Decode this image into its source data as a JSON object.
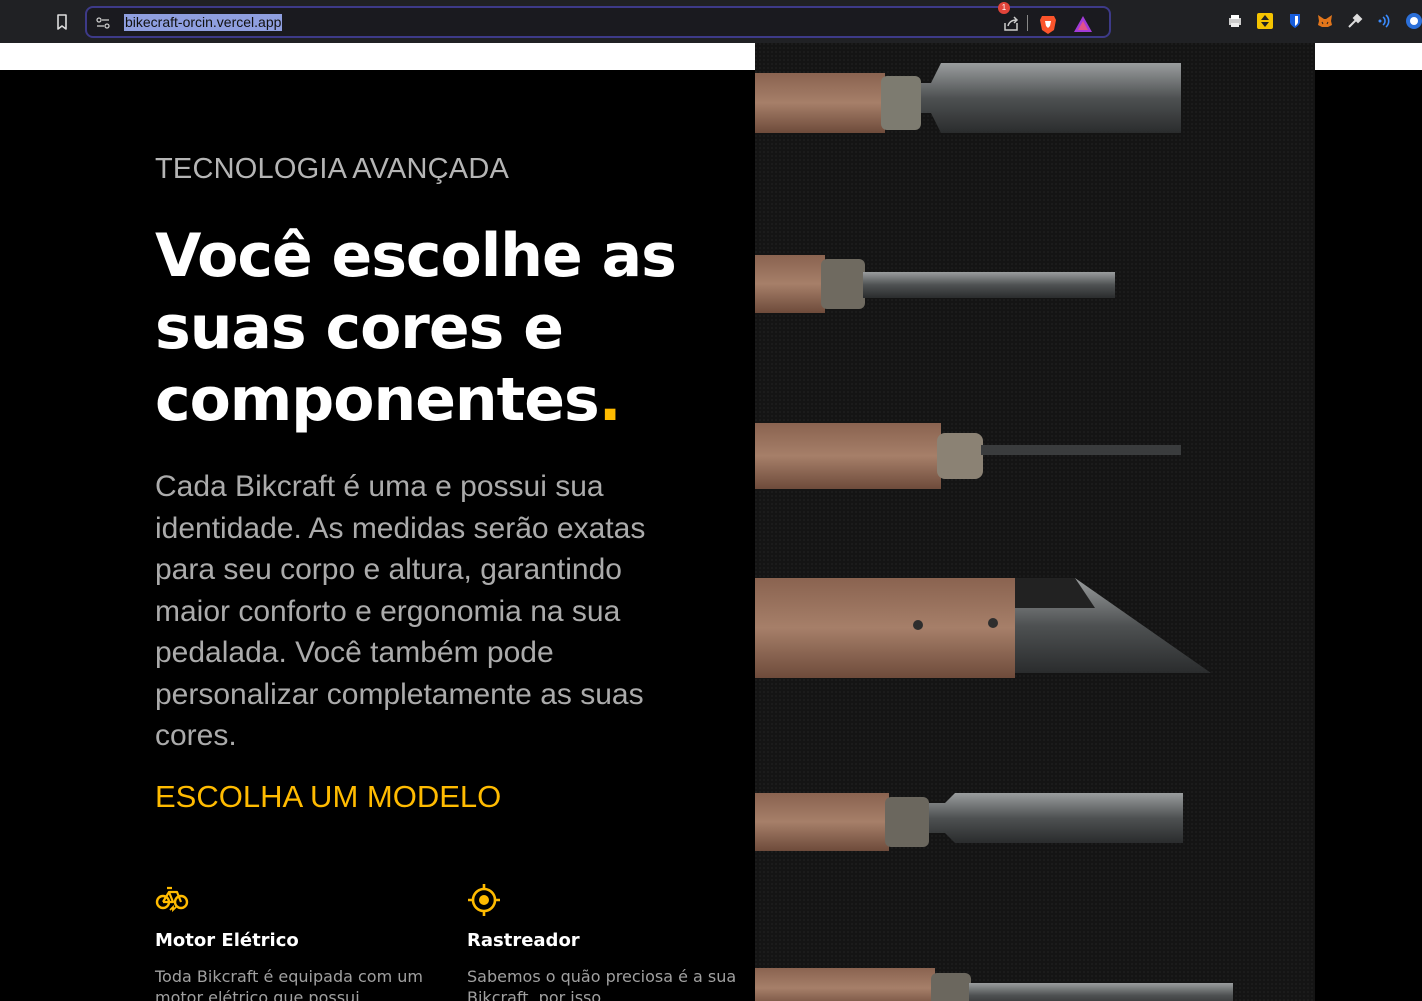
{
  "browser": {
    "url": "bikecraft-orcin.vercel.app",
    "rewards_badge": "1",
    "icons": [
      "bookmark-icon",
      "site-info-icon",
      "share-icon",
      "brave-lion-icon",
      "brave-rewards-icon",
      "print-icon",
      "extension-yellow-icon",
      "bitwarden-icon",
      "metamask-fox-icon",
      "color-picker-icon",
      "wifi-signal-icon",
      "profile-icon"
    ]
  },
  "hero": {
    "eyebrow": "TECNOLOGIA AVANÇADA",
    "headline": "Você escolhe as suas cores e componentes",
    "headline_dot": ".",
    "paragraph": "Cada Bikcraft é uma e possui sua identidade. As medidas serão exatas para seu corpo e altura, garantindo maior conforto e ergonomia na sua pedalada. Você também pode personalizar completamente as suas cores.",
    "cta": "ESCOLHA UM MODELO"
  },
  "features": [
    {
      "icon": "electric-bike-icon",
      "title": "Motor Elétrico",
      "text": "Toda Bikcraft é equipada com um motor elétrico que possui"
    },
    {
      "icon": "target-tracker-icon",
      "title": "Rastreador",
      "text": "Sabemos o quão preciosa é a sua Bikcraft, por isso"
    }
  ],
  "image": {
    "subject": "carving-tools-photo"
  },
  "colors": {
    "accent": "#ffbb00",
    "background": "#000000",
    "text_muted": "#ababab"
  }
}
